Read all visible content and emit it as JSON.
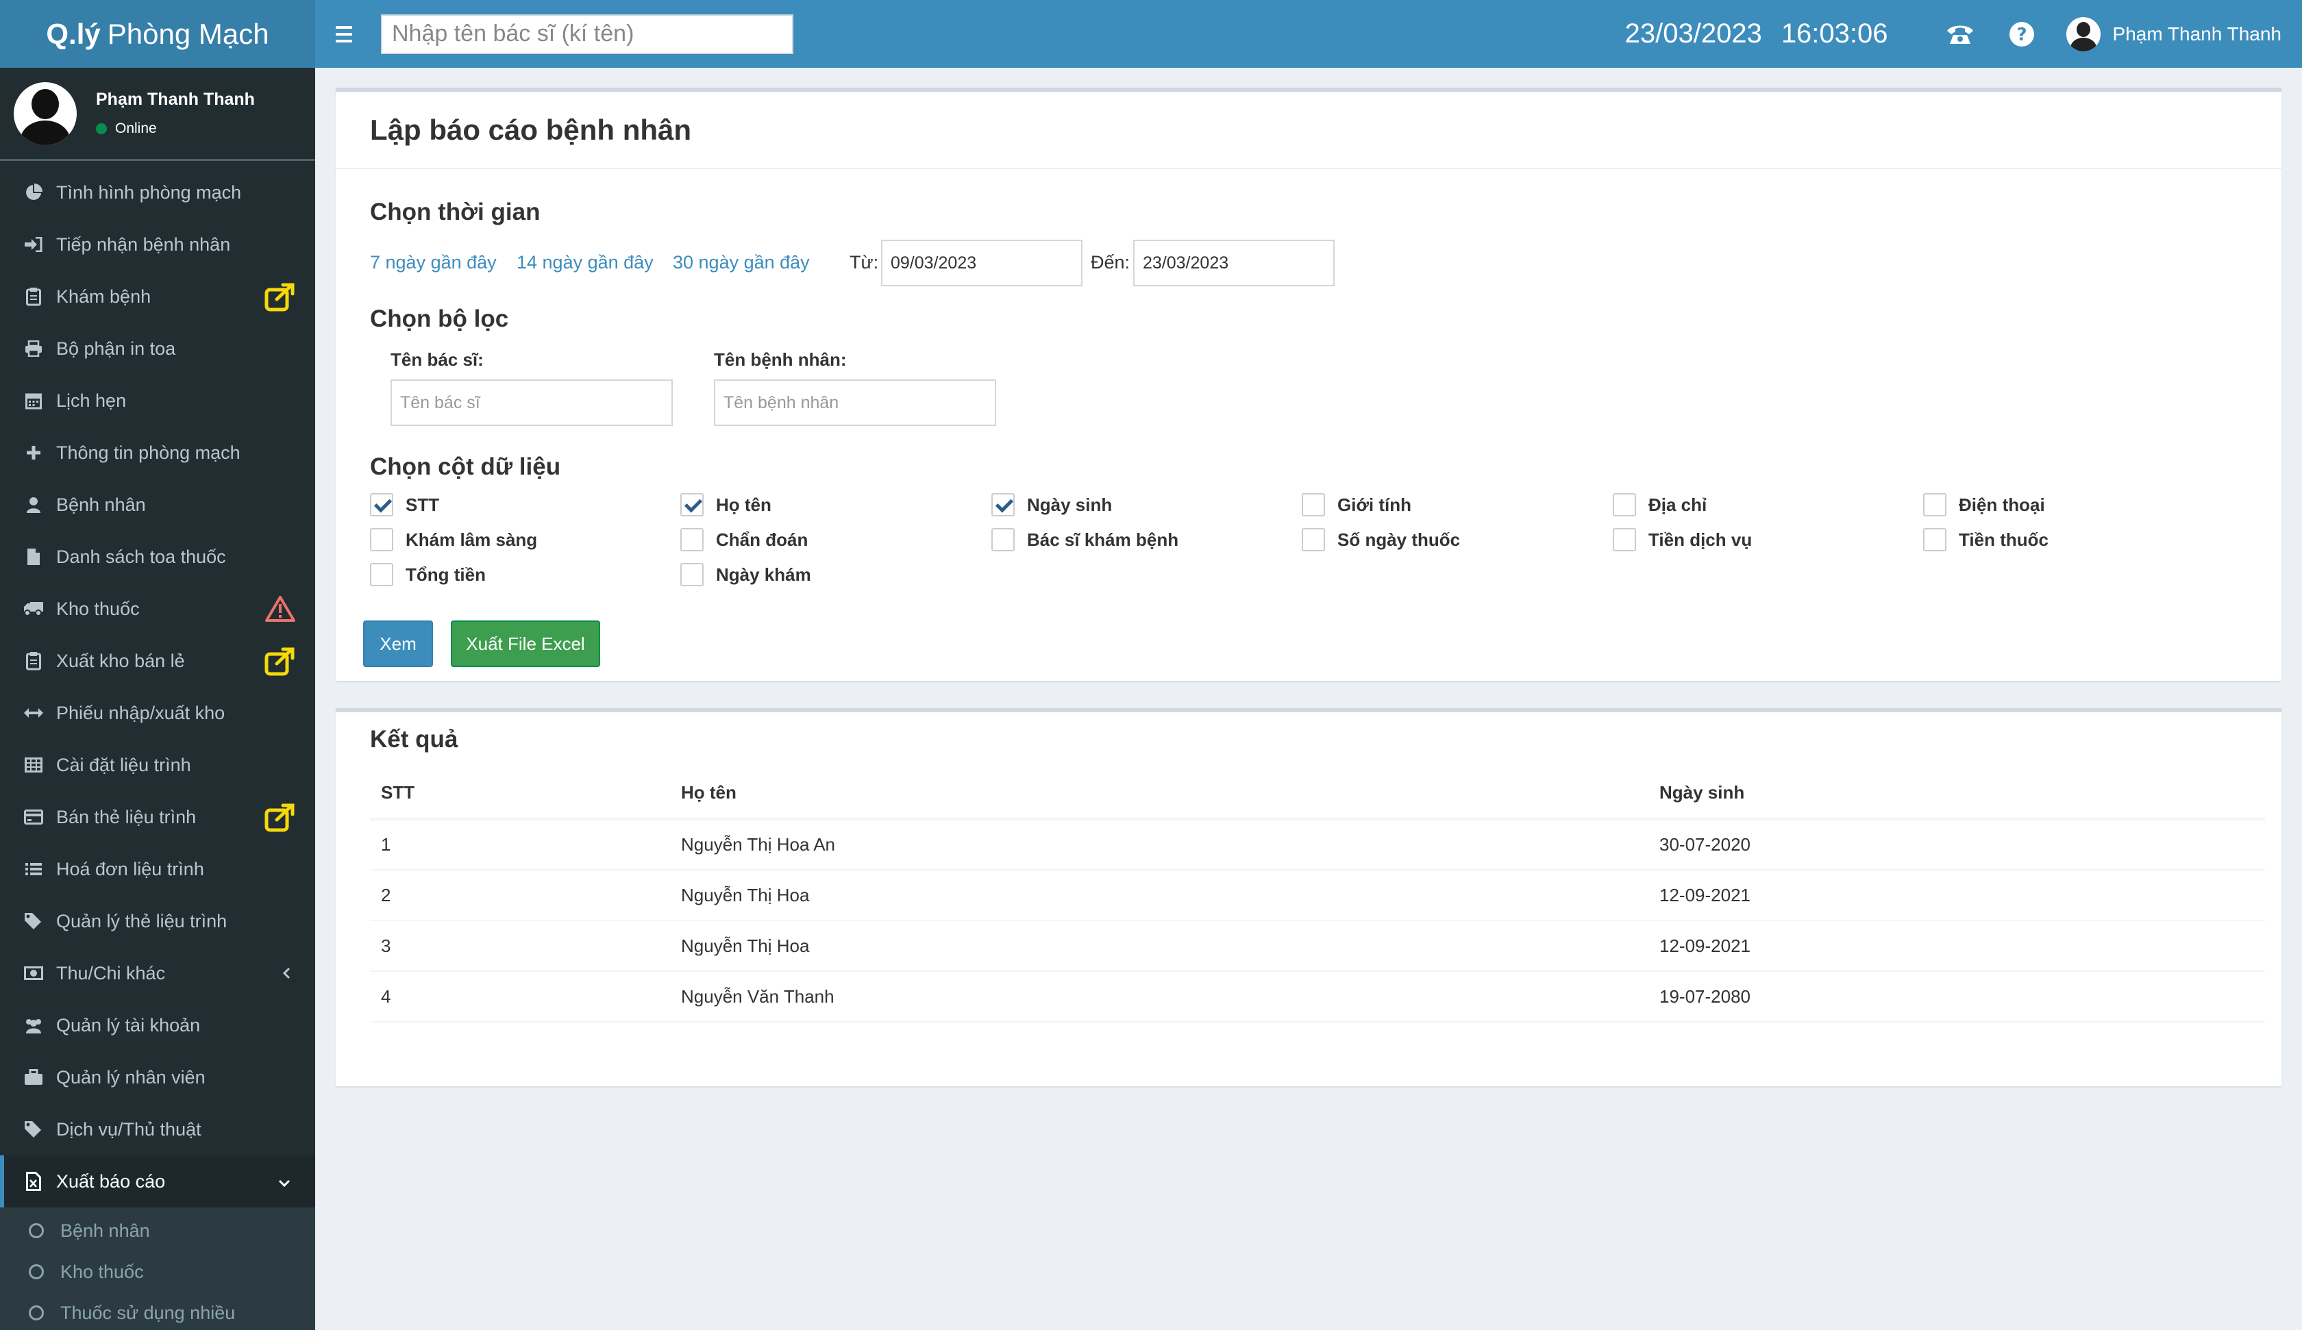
{
  "header": {
    "logo_bold": "Q.lý",
    "logo_text": "Phòng Mạch",
    "search_placeholder": "Nhập tên bác sĩ (kí tên)",
    "date": "23/03/2023",
    "time": "16:03:06",
    "user_name": "Phạm Thanh Thanh",
    "brand_color": "#3c8dbc"
  },
  "sidebar": {
    "user_name": "Phạm Thanh Thanh",
    "status": "Online",
    "items": [
      {
        "label": "Tình hình phòng mạch",
        "icon": "pie-chart-icon"
      },
      {
        "label": "Tiếp nhận bệnh nhân",
        "icon": "sign-in-icon"
      },
      {
        "label": "Khám bệnh",
        "icon": "clipboard-icon",
        "badge": "external-link-icon"
      },
      {
        "label": "Bộ phận in toa",
        "icon": "print-icon"
      },
      {
        "label": "Lịch hẹn",
        "icon": "calendar-icon"
      },
      {
        "label": "Thông tin phòng mạch",
        "icon": "plus-icon"
      },
      {
        "label": "Bệnh nhân",
        "icon": "user-icon"
      },
      {
        "label": "Danh sách toa thuốc",
        "icon": "file-icon"
      },
      {
        "label": "Kho thuốc",
        "icon": "truck-icon",
        "badge": "warning-icon"
      },
      {
        "label": "Xuất kho bán lẻ",
        "icon": "clipboard-icon",
        "badge": "external-link-icon"
      },
      {
        "label": "Phiếu nhập/xuất kho",
        "icon": "arrows-h-icon"
      },
      {
        "label": "Cài đặt liệu trình",
        "icon": "table-icon"
      },
      {
        "label": "Bán thẻ liệu trình",
        "icon": "credit-card-icon",
        "badge": "external-link-icon"
      },
      {
        "label": "Hoá đơn liệu trình",
        "icon": "list-icon"
      },
      {
        "label": "Quản lý thẻ liệu trình",
        "icon": "tags-icon"
      },
      {
        "label": "Thu/Chi khác",
        "icon": "money-icon",
        "chevron": "chevron-left-icon"
      },
      {
        "label": "Quản lý tài khoản",
        "icon": "users-icon"
      },
      {
        "label": "Quản lý nhân viên",
        "icon": "briefcase-icon"
      },
      {
        "label": "Dịch vụ/Thủ thuật",
        "icon": "tags-icon"
      },
      {
        "label": "Xuất báo cáo",
        "icon": "file-excel-icon",
        "chevron": "chevron-down-icon",
        "active": true
      }
    ],
    "subitems": [
      "Bệnh nhân",
      "Kho thuốc",
      "Thuốc sử dụng nhiều"
    ]
  },
  "report": {
    "title": "Lập báo cáo bệnh nhân",
    "time_section": "Chọn thời gian",
    "quick_links": [
      "7 ngày gần đây",
      "14 ngày gần đây",
      "30 ngày gần đây"
    ],
    "from_label": "Từ:",
    "from_value": "09/03/2023",
    "to_label": "Đến:",
    "to_value": "23/03/2023",
    "filter_section": "Chọn bộ lọc",
    "doctor_label": "Tên bác sĩ:",
    "doctor_placeholder": "Tên bác sĩ",
    "patient_label": "Tên bệnh nhân:",
    "patient_placeholder": "Tên bệnh nhân",
    "columns_section": "Chọn cột dữ liệu",
    "columns": [
      {
        "label": "STT",
        "checked": true
      },
      {
        "label": "Họ tên",
        "checked": true
      },
      {
        "label": "Ngày sinh",
        "checked": true
      },
      {
        "label": "Giới tính",
        "checked": false
      },
      {
        "label": "Địa chỉ",
        "checked": false
      },
      {
        "label": "Điện thoại",
        "checked": false
      },
      {
        "label": "Khám lâm sàng",
        "checked": false
      },
      {
        "label": "Chẩn đoán",
        "checked": false
      },
      {
        "label": "Bác sĩ khám bệnh",
        "checked": false
      },
      {
        "label": "Số ngày thuốc",
        "checked": false
      },
      {
        "label": "Tiền dịch vụ",
        "checked": false
      },
      {
        "label": "Tiền thuốc",
        "checked": false
      },
      {
        "label": "Tổng tiền",
        "checked": false
      },
      {
        "label": "Ngày khám",
        "checked": false
      }
    ],
    "view_button": "Xem",
    "excel_button": "Xuất File Excel"
  },
  "results": {
    "title": "Kết quả",
    "headers": [
      "STT",
      "Họ tên",
      "Ngày sinh"
    ],
    "rows": [
      [
        "1",
        "Nguyễn Thị Hoa An",
        "30-07-2020"
      ],
      [
        "2",
        "Nguyễn Thị Hoa",
        "12-09-2021"
      ],
      [
        "3",
        "Nguyễn Thị Hoa",
        "12-09-2021"
      ],
      [
        "4",
        "Nguyễn Văn Thanh",
        "19-07-2080"
      ]
    ]
  }
}
